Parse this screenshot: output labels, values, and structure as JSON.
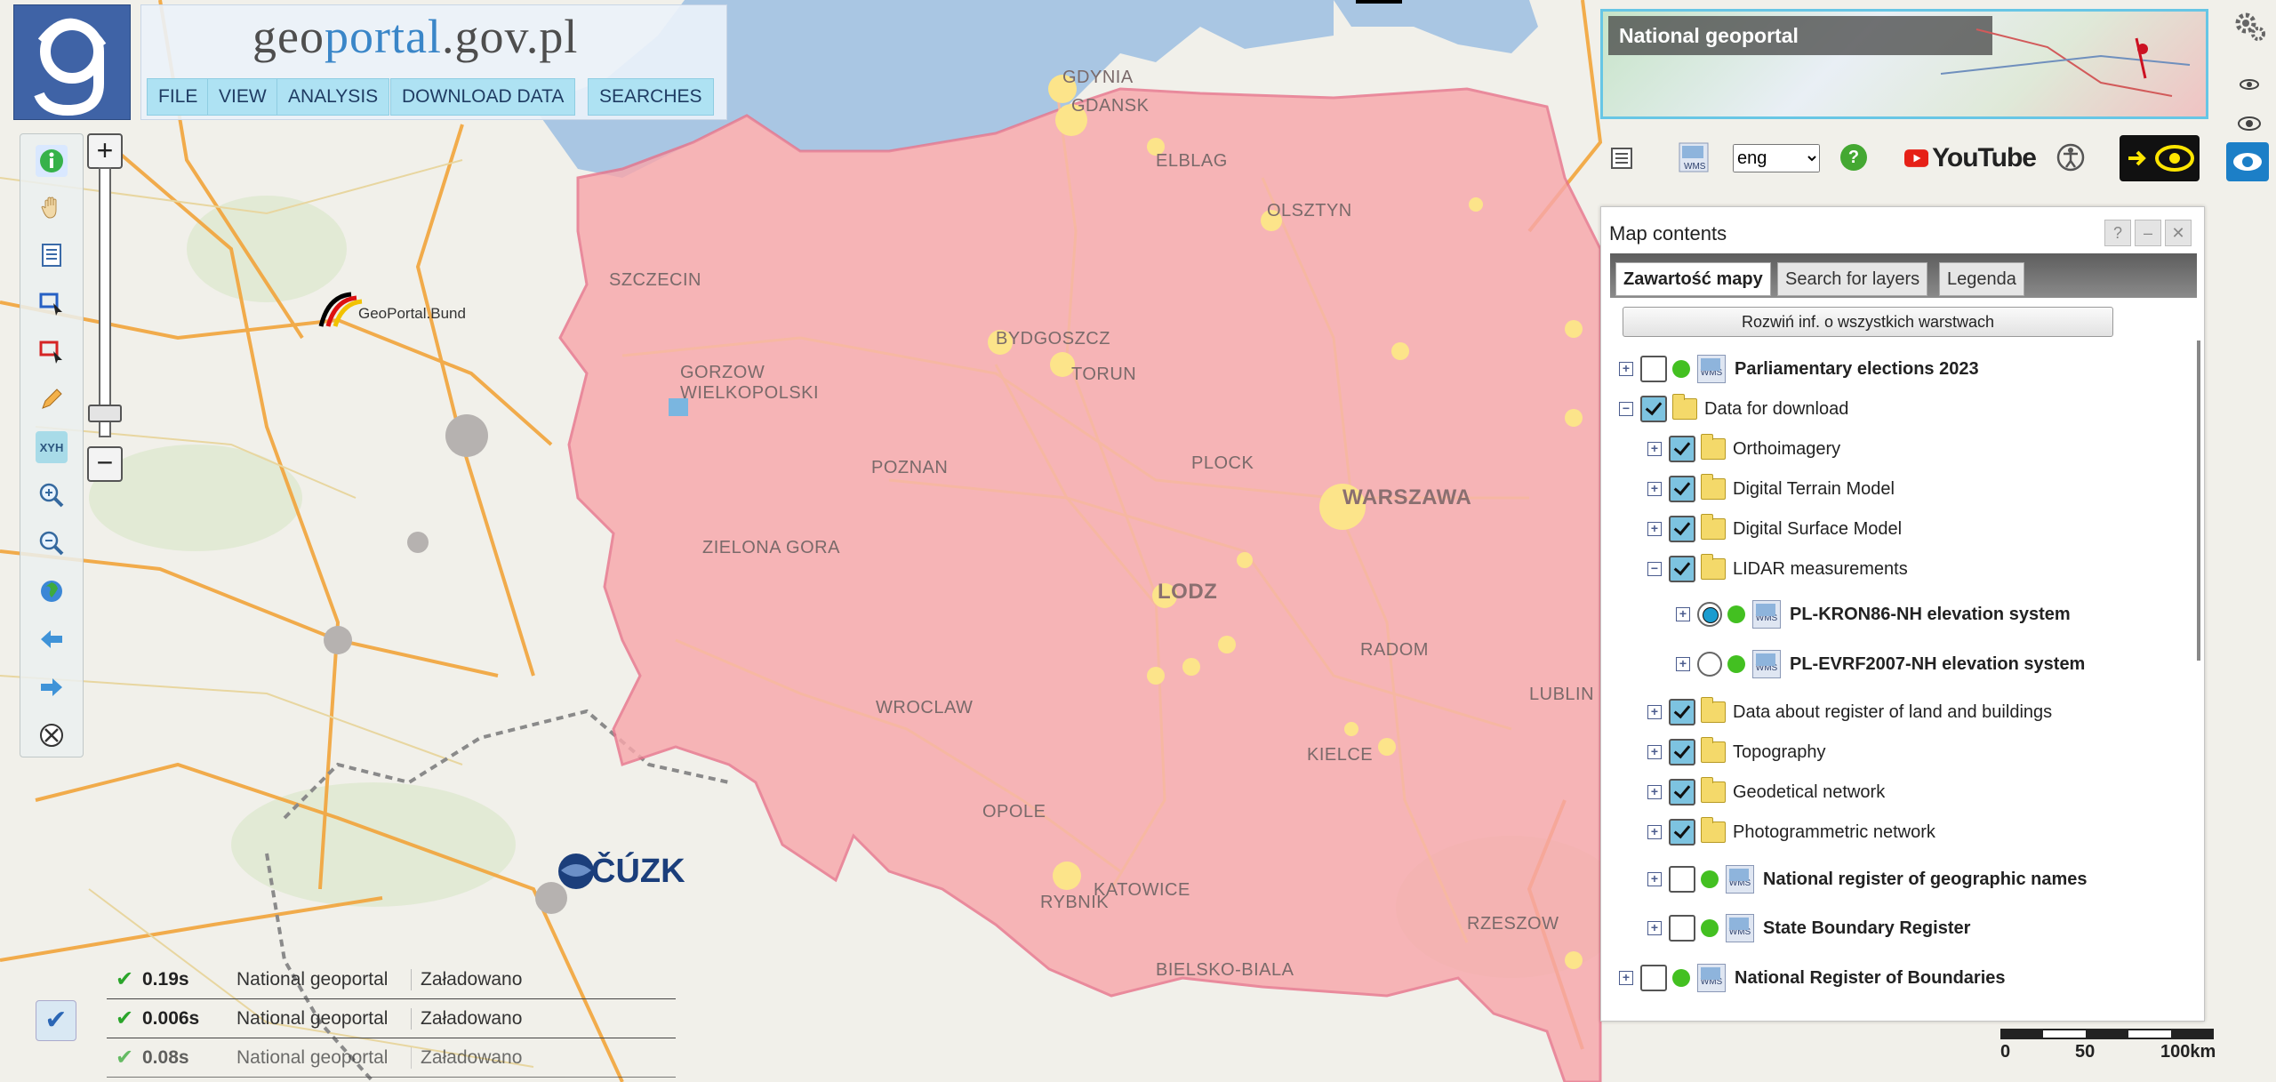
{
  "header": {
    "site_title_prefix": "geo",
    "site_title_mid": "portal",
    "site_title_suffix": ".gov.pl",
    "menu": [
      "FILE",
      "VIEW",
      "ANALYSIS",
      "DOWNLOAD DATA",
      "SEARCHES"
    ]
  },
  "map": {
    "city_labels": [
      "GDYNIA",
      "GDANSK",
      "ELBLAG",
      "OLSZTYN",
      "SZCZECIN",
      "GORZOW WIELKOPOLSKI",
      "BYDGOSZCZ",
      "TORUN",
      "POZNAN",
      "PLOCK",
      "WARSZAWA",
      "ZIELONA GORA",
      "LODZ",
      "RADOM",
      "WROCLAW",
      "OPOLE",
      "KIELCE",
      "LUBLIN",
      "KATOWICE",
      "RYBNIK",
      "RZESZOW",
      "BIELSKO-BIALA"
    ],
    "partner_logo_1": "GeoPortal.Bund",
    "partner_logo_2": "ČÚZK"
  },
  "top_right": {
    "overview_label": "National geoportal",
    "language": "eng",
    "youtube_label": "YouTube"
  },
  "contents_panel": {
    "title": "Map contents",
    "win_buttons": [
      "?",
      "–",
      "✕"
    ],
    "tabs": [
      "Zawartość mapy",
      "Search for layers",
      "Legenda"
    ],
    "active_tab": "Zawartość mapy",
    "expand_all": "Rozwiń inf. o wszystkich warstwach",
    "tree": [
      {
        "label": "Parliamentary elections 2023",
        "bold": true,
        "level": 0,
        "expander": "+",
        "control": "checkbox",
        "checked": false,
        "dot": true,
        "wms": true
      },
      {
        "label": "Data for download",
        "bold": false,
        "level": 0,
        "expander": "−",
        "control": "checkbox",
        "checked": true,
        "folder": true
      },
      {
        "label": "Orthoimagery",
        "bold": false,
        "level": 1,
        "expander": "+",
        "control": "checkbox",
        "checked": true,
        "folder": true
      },
      {
        "label": "Digital Terrain Model",
        "bold": false,
        "level": 1,
        "expander": "+",
        "control": "checkbox",
        "checked": true,
        "folder": true
      },
      {
        "label": "Digital Surface Model",
        "bold": false,
        "level": 1,
        "expander": "+",
        "control": "checkbox",
        "checked": true,
        "folder": true
      },
      {
        "label": "LIDAR measurements",
        "bold": false,
        "level": 1,
        "expander": "−",
        "control": "checkbox",
        "checked": true,
        "folder": true
      },
      {
        "label": "PL-KRON86-NH elevation system",
        "bold": true,
        "level": 2,
        "expander": "+",
        "control": "radio",
        "checked": true,
        "dot": true,
        "wms": true
      },
      {
        "label": "PL-EVRF2007-NH elevation system",
        "bold": true,
        "level": 2,
        "expander": "+",
        "control": "radio",
        "checked": false,
        "dot": true,
        "wms": true
      },
      {
        "label": "Data about register of land and buildings",
        "bold": false,
        "level": 1,
        "expander": "+",
        "control": "checkbox",
        "checked": true,
        "folder": true
      },
      {
        "label": "Topography",
        "bold": false,
        "level": 1,
        "expander": "+",
        "control": "checkbox",
        "checked": true,
        "folder": true
      },
      {
        "label": "Geodetical network",
        "bold": false,
        "level": 1,
        "expander": "+",
        "control": "checkbox",
        "checked": true,
        "folder": true
      },
      {
        "label": "Photogrammetric network",
        "bold": false,
        "level": 1,
        "expander": "+",
        "control": "checkbox",
        "checked": true,
        "folder": true
      },
      {
        "label": "National register of geographic names",
        "bold": true,
        "level": 1,
        "expander": "+",
        "control": "checkbox",
        "checked": false,
        "dot": true,
        "wms": true
      },
      {
        "label": "State Boundary Register",
        "bold": true,
        "level": 1,
        "expander": "+",
        "control": "checkbox",
        "checked": false,
        "dot": true,
        "wms": true
      },
      {
        "label": "National Register of Boundaries",
        "bold": true,
        "level": 0,
        "expander": "+",
        "control": "checkbox",
        "checked": false,
        "dot": true,
        "wms": true
      }
    ]
  },
  "status": [
    {
      "time": "0.19s",
      "source": "National geoportal",
      "state": "Załadowano"
    },
    {
      "time": "0.006s",
      "source": "National geoportal",
      "state": "Załadowano"
    },
    {
      "time": "0.08s",
      "source": "National geoportal",
      "state": "Załadowano"
    }
  ],
  "scale": {
    "ticks": [
      "0",
      "50",
      "100km"
    ]
  },
  "colors": {
    "poland_fill": "#f8a7ab",
    "poland_border": "#e8748b",
    "sea": "#aac8e4",
    "road": "#f2a43a",
    "menu_bg": "#aee2f3",
    "accent": "#3f63a6"
  }
}
